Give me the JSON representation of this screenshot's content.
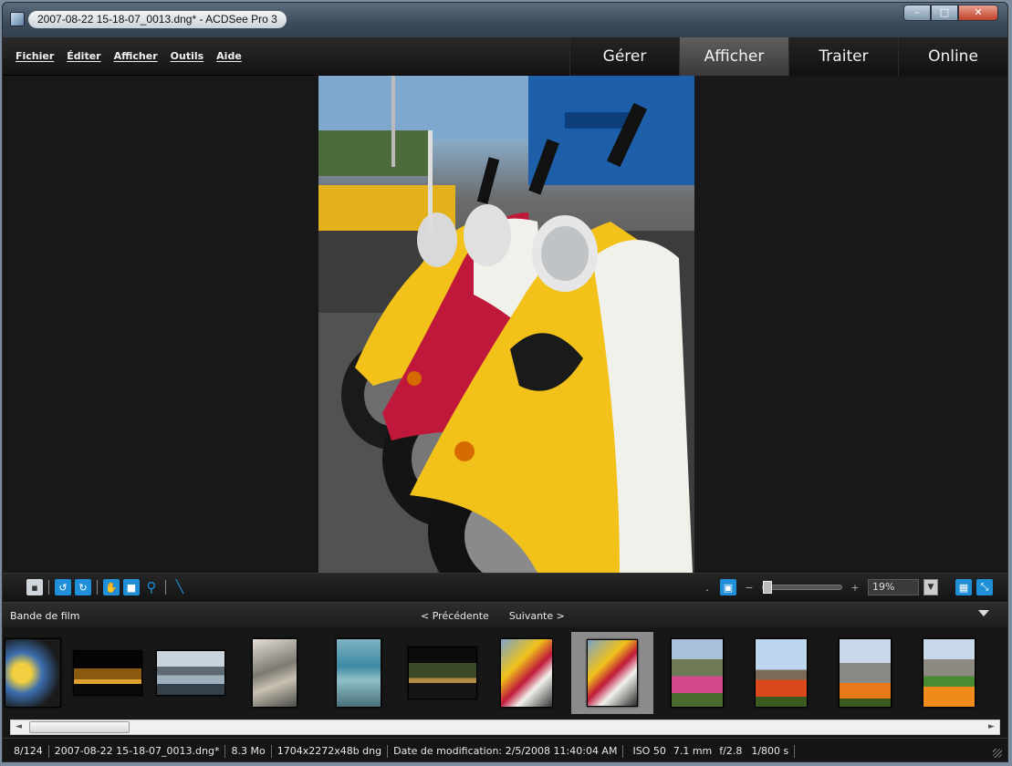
{
  "window": {
    "title": "2007-08-22 15-18-07_0013.dng* - ACDSee Pro 3",
    "min_glyph": "–",
    "max_glyph": "□",
    "close_glyph": "✕"
  },
  "menu": {
    "items": [
      "Fichier",
      "Éditer",
      "Afficher",
      "Outils",
      "Aide"
    ]
  },
  "modes": {
    "items": [
      "Gérer",
      "Afficher",
      "Traiter",
      "Online"
    ],
    "active": "Afficher"
  },
  "toolbar": {
    "zoom_value": "19%",
    "minus_glyph": "−",
    "plus_glyph": "+",
    "dropdown_glyph": "▼"
  },
  "filmstrip": {
    "label": "Bande de film",
    "prev_label": "< Précédente",
    "next_label": "Suivante >",
    "selected_index": 7
  },
  "scrollbar": {
    "left_glyph": "◄",
    "right_glyph": "►"
  },
  "status": {
    "position": "8/124",
    "filename": "2007-08-22 15-18-07_0013.dng*",
    "filesize": "8.3 Mo",
    "dimensions": "1704x2272x48b dng",
    "modified": "Date de modification: 2/5/2008 11:40:04 AM",
    "iso": "ISO 50",
    "focal": "7.1 mm",
    "aperture": "f/2.8",
    "shutter": "1/800 s"
  },
  "colors": {
    "accent": "#1f8fd8",
    "scooter_yellow": "#f2c21a",
    "scooter_red": "#c0183a",
    "scooter_white": "#f1f1ec"
  }
}
